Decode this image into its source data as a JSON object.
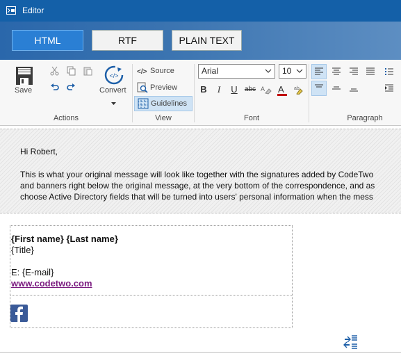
{
  "window": {
    "title": "Editor"
  },
  "modes": {
    "html": "HTML",
    "rtf": "RTF",
    "plain": "PLAIN TEXT",
    "active": "HTML"
  },
  "ribbon": {
    "actions": {
      "label": "Actions",
      "save": "Save",
      "convert": "Convert"
    },
    "view": {
      "label": "View",
      "source": "Source",
      "preview": "Preview",
      "guidelines": "Guidelines"
    },
    "font": {
      "label": "Font",
      "family": "Arial",
      "size": "10"
    },
    "paragraph": {
      "label": "Paragraph"
    }
  },
  "message": {
    "greeting": "Hi Robert,",
    "line1": "This is what your original message will look like together with the signatures added by CodeTwo",
    "line2": "and banners right below the original message, at the very bottom of the correspondence, and as",
    "line3": "choose Active Directory fields that will be turned into users' personal information when the mess"
  },
  "signature": {
    "name": "{First name} {Last name}",
    "title": "{Title}",
    "email": "E: {E-mail}",
    "website": "www.codetwo.com"
  },
  "colors": {
    "titlebar": "#1460a8",
    "active_mode": "#2a7fd4",
    "link": "#7b1b80",
    "facebook": "#3a5a98"
  }
}
